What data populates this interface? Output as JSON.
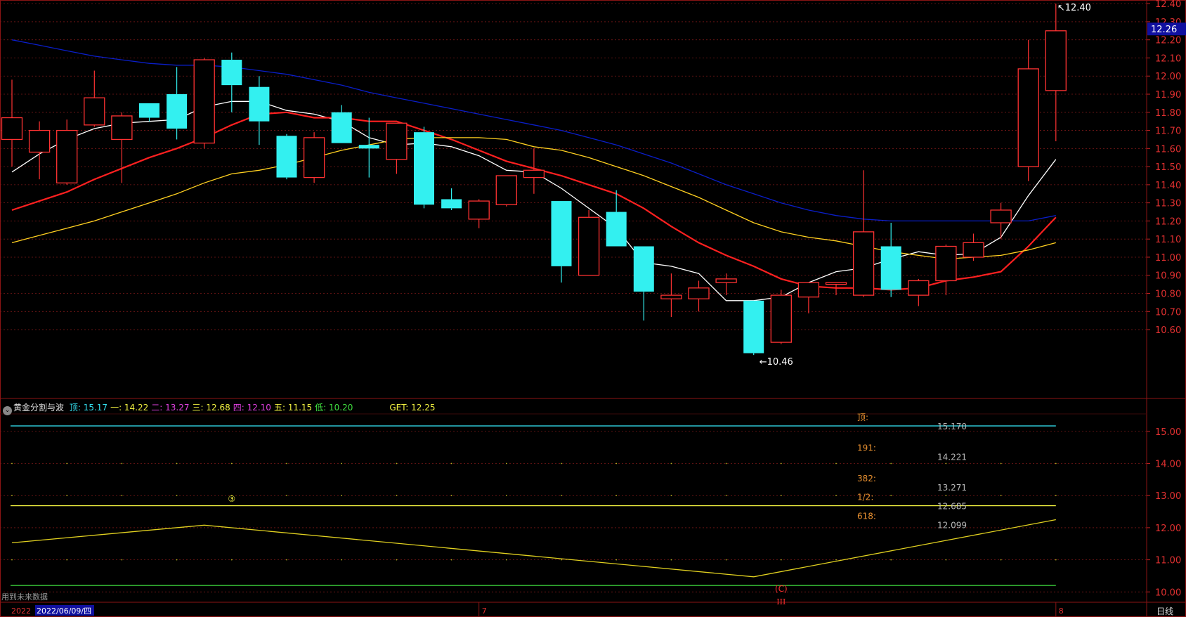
{
  "chart_data": {
    "type": "candlestick",
    "price_axis": {
      "ticks": [
        "12.40",
        "12.30",
        "12.20",
        "12.10",
        "12.00",
        "11.90",
        "11.80",
        "11.70",
        "11.60",
        "11.50",
        "11.40",
        "11.30",
        "11.20",
        "11.10",
        "11.00",
        "10.90",
        "10.80",
        "10.70",
        "10.60"
      ],
      "ylim": [
        10.22,
        12.42
      ],
      "current_price": "12.26"
    },
    "annotations": {
      "high": "12.40",
      "low": "10.46"
    },
    "candles": [
      {
        "o": 11.65,
        "h": 11.98,
        "l": 11.5,
        "c": 11.77
      },
      {
        "o": 11.58,
        "h": 11.75,
        "l": 11.43,
        "c": 11.7
      },
      {
        "o": 11.41,
        "h": 11.76,
        "l": 11.4,
        "c": 11.7
      },
      {
        "o": 11.73,
        "h": 12.03,
        "l": 11.72,
        "c": 11.88
      },
      {
        "o": 11.65,
        "h": 11.8,
        "l": 11.41,
        "c": 11.78
      },
      {
        "o": 11.85,
        "h": 11.85,
        "l": 11.75,
        "c": 11.77
      },
      {
        "o": 11.9,
        "h": 12.05,
        "l": 11.65,
        "c": 11.71
      },
      {
        "o": 11.63,
        "h": 12.1,
        "l": 11.6,
        "c": 12.09
      },
      {
        "o": 12.09,
        "h": 12.13,
        "l": 11.8,
        "c": 11.95
      },
      {
        "o": 11.94,
        "h": 12.0,
        "l": 11.62,
        "c": 11.75
      },
      {
        "o": 11.67,
        "h": 11.68,
        "l": 11.43,
        "c": 11.44
      },
      {
        "o": 11.44,
        "h": 11.69,
        "l": 11.41,
        "c": 11.66
      },
      {
        "o": 11.8,
        "h": 11.84,
        "l": 11.63,
        "c": 11.63
      },
      {
        "o": 11.62,
        "h": 11.77,
        "l": 11.44,
        "c": 11.6
      },
      {
        "o": 11.54,
        "h": 11.73,
        "l": 11.46,
        "c": 11.74
      },
      {
        "o": 11.69,
        "h": 11.72,
        "l": 11.27,
        "c": 11.29
      },
      {
        "o": 11.32,
        "h": 11.38,
        "l": 11.26,
        "c": 11.27
      },
      {
        "o": 11.21,
        "h": 11.32,
        "l": 11.16,
        "c": 11.31
      },
      {
        "o": 11.29,
        "h": 11.44,
        "l": 11.28,
        "c": 11.45
      },
      {
        "o": 11.44,
        "h": 11.6,
        "l": 11.35,
        "c": 11.48
      },
      {
        "o": 11.31,
        "h": 11.31,
        "l": 10.86,
        "c": 10.95
      },
      {
        "o": 10.9,
        "h": 11.26,
        "l": 10.9,
        "c": 11.22
      },
      {
        "o": 11.25,
        "h": 11.37,
        "l": 11.06,
        "c": 11.06
      },
      {
        "o": 11.06,
        "h": 11.06,
        "l": 10.65,
        "c": 10.81
      },
      {
        "o": 10.77,
        "h": 10.91,
        "l": 10.67,
        "c": 10.79
      },
      {
        "o": 10.77,
        "h": 10.87,
        "l": 10.7,
        "c": 10.83
      },
      {
        "o": 10.86,
        "h": 10.91,
        "l": 10.79,
        "c": 10.88
      },
      {
        "o": 10.76,
        "h": 10.76,
        "l": 10.46,
        "c": 10.47
      },
      {
        "o": 10.53,
        "h": 10.82,
        "l": 10.52,
        "c": 10.79
      },
      {
        "o": 10.78,
        "h": 10.86,
        "l": 10.69,
        "c": 10.86
      },
      {
        "o": 10.85,
        "h": 10.86,
        "l": 10.79,
        "c": 10.86
      },
      {
        "o": 10.79,
        "h": 11.48,
        "l": 10.78,
        "c": 11.14
      },
      {
        "o": 11.06,
        "h": 11.19,
        "l": 10.78,
        "c": 10.82
      },
      {
        "o": 10.79,
        "h": 10.88,
        "l": 10.73,
        "c": 10.87
      },
      {
        "o": 10.87,
        "h": 11.07,
        "l": 10.79,
        "c": 11.06
      },
      {
        "o": 11.0,
        "h": 11.13,
        "l": 10.98,
        "c": 11.08
      },
      {
        "o": 11.19,
        "h": 11.3,
        "l": 11.1,
        "c": 11.26
      },
      {
        "o": 11.5,
        "h": 12.2,
        "l": 11.42,
        "c": 12.04
      },
      {
        "o": 11.92,
        "h": 12.4,
        "l": 11.64,
        "c": 12.25
      }
    ],
    "ma_lines": [
      {
        "color": "#ffffff",
        "values": [
          11.47,
          11.57,
          11.65,
          11.71,
          11.74,
          11.75,
          11.76,
          11.83,
          11.86,
          11.86,
          11.81,
          11.79,
          11.75,
          11.66,
          11.62,
          11.63,
          11.61,
          11.56,
          11.48,
          11.47,
          11.38,
          11.27,
          11.16,
          10.97,
          10.95,
          10.91,
          10.76,
          10.76,
          10.78,
          10.86,
          10.92,
          10.94,
          10.99,
          11.03,
          11.01,
          11.02,
          11.11,
          11.34,
          11.54
        ]
      },
      {
        "color": "#ff2020",
        "values": [
          11.26,
          11.31,
          11.36,
          11.43,
          11.49,
          11.55,
          11.6,
          11.66,
          11.73,
          11.79,
          11.8,
          11.77,
          11.77,
          11.75,
          11.75,
          11.7,
          11.65,
          11.59,
          11.53,
          11.49,
          11.45,
          11.4,
          11.35,
          11.27,
          11.17,
          11.08,
          11.01,
          10.95,
          10.88,
          10.84,
          10.83,
          10.83,
          10.82,
          10.83,
          10.87,
          10.89,
          10.92,
          11.06,
          11.22
        ]
      },
      {
        "color": "#ffd020",
        "values": [
          11.08,
          11.12,
          11.16,
          11.2,
          11.25,
          11.3,
          11.35,
          11.41,
          11.46,
          11.48,
          11.51,
          11.55,
          11.59,
          11.62,
          11.65,
          11.66,
          11.66,
          11.66,
          11.65,
          11.61,
          11.59,
          11.55,
          11.5,
          11.45,
          11.39,
          11.33,
          11.26,
          11.19,
          11.14,
          11.11,
          11.09,
          11.06,
          11.03,
          11.01,
          10.99,
          11.0,
          11.01,
          11.04,
          11.08
        ]
      },
      {
        "color": "#0a1ec8",
        "values": [
          12.2,
          12.17,
          12.14,
          12.11,
          12.09,
          12.07,
          12.06,
          12.06,
          12.05,
          12.03,
          12.01,
          11.98,
          11.95,
          11.91,
          11.88,
          11.85,
          11.82,
          11.79,
          11.76,
          11.73,
          11.7,
          11.66,
          11.62,
          11.57,
          11.52,
          11.46,
          11.4,
          11.35,
          11.3,
          11.26,
          11.23,
          11.21,
          11.2,
          11.2,
          11.2,
          11.2,
          11.2,
          11.2,
          11.23
        ]
      }
    ],
    "indicator": {
      "name": "黄金分割与波",
      "ylim": [
        9.7,
        15.5
      ],
      "ticks": [
        "15.00",
        "14.00",
        "13.00",
        "12.00",
        "11.00",
        "10.00"
      ],
      "params": [
        {
          "label": "顶:",
          "value": "15.17",
          "color": "#33e0f0"
        },
        {
          "label": "一:",
          "value": "14.22",
          "color": "#f0f040"
        },
        {
          "label": "二:",
          "value": "13.27",
          "color": "#e040e0"
        },
        {
          "label": "三:",
          "value": "12.68",
          "color": "#f0f040"
        },
        {
          "label": "四:",
          "value": "12.10",
          "color": "#e040e0"
        },
        {
          "label": "五:",
          "value": "11.15",
          "color": "#f0f040"
        },
        {
          "label": "低:",
          "value": "10.20",
          "color": "#40e040"
        },
        {
          "label": "GET:",
          "value": "12.25",
          "color": "#f0f040"
        }
      ],
      "levels": [
        {
          "value": 15.17,
          "value_label": "15.170",
          "name": "顶:",
          "color": "#33e0f0"
        },
        {
          "value": 14.221,
          "value_label": "14.221",
          "name": "191:",
          "color": "#b0b0b0"
        },
        {
          "value": 13.271,
          "value_label": "13.271",
          "name": "382:",
          "color": "#b0b0b0"
        },
        {
          "value": 12.685,
          "value_label": "12.685",
          "name": "1/2:",
          "color": "#f0f040"
        },
        {
          "value": 12.099,
          "value_label": "12.099",
          "name": "618:",
          "color": "#b0b0b0"
        },
        {
          "value": 10.2,
          "value_label": "",
          "name": "",
          "color": "#40e040"
        }
      ],
      "wave": [
        {
          "x": 0,
          "y": 11.53
        },
        {
          "x": 7,
          "y": 12.08
        },
        {
          "x": 27,
          "y": 10.47
        },
        {
          "x": 38,
          "y": 12.25
        }
      ],
      "wave_labels": [
        {
          "text": "③",
          "x": 8,
          "y": 12.92,
          "color": "#f0f040"
        },
        {
          "text": "(C)",
          "x": 28,
          "y": 10.12,
          "color": "#ff3030"
        }
      ]
    },
    "footer": {
      "note": "用到未来数据",
      "date_prefix": "2022",
      "date": "2022/06/09/四",
      "month_marks": [
        {
          "label": "7",
          "x": 17
        },
        {
          "label": "8",
          "x": 38
        }
      ],
      "roman": "III",
      "period": "日线"
    }
  }
}
